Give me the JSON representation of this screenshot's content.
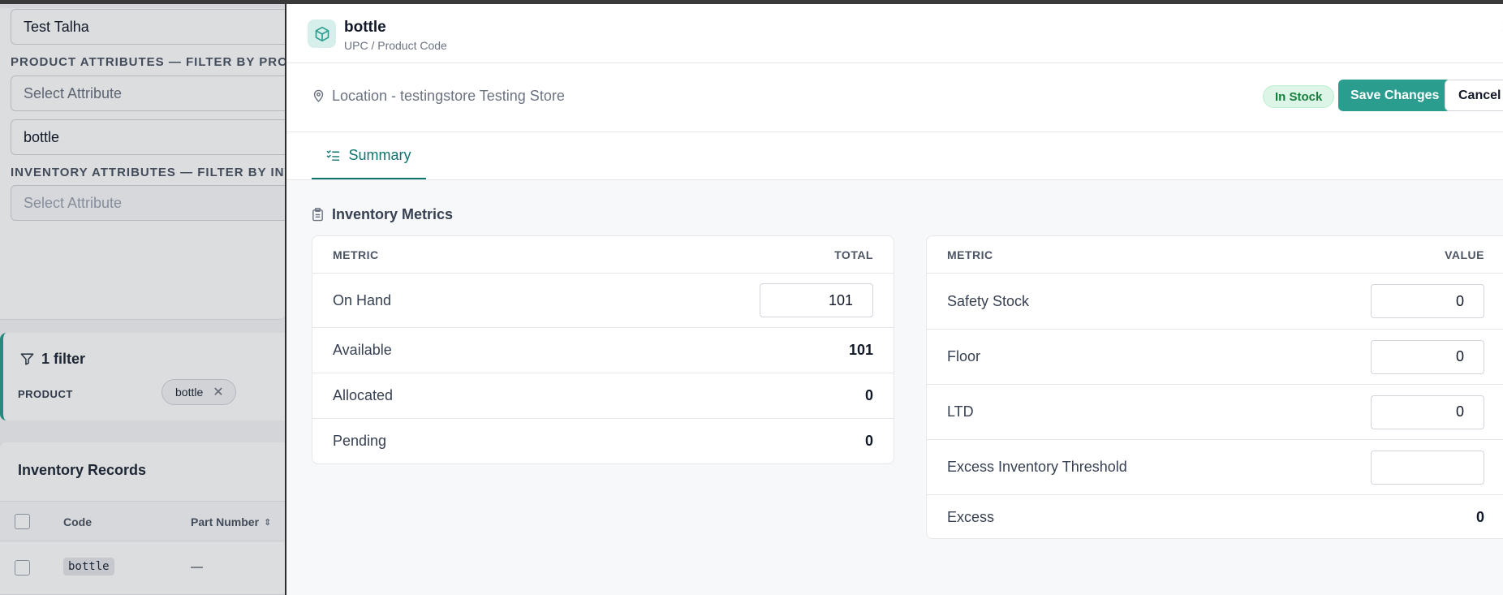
{
  "background": {
    "user_value": "Test Talha",
    "product_attributes_label": "PRODUCT ATTRIBUTES — FILTER BY PRODUCT",
    "product_attribute_placeholder": "Select Attribute",
    "product_value": "bottle",
    "inventory_attributes_label": "INVENTORY ATTRIBUTES — FILTER BY INVENTORY",
    "inventory_attribute_placeholder": "Select Attribute",
    "filter_count_label": "1 filter",
    "filter_product_label": "PRODUCT",
    "filter_chip_value": "bottle",
    "records_title": "Inventory Records",
    "columns": [
      "Code",
      "Part Number"
    ],
    "row_code": "bottle",
    "row_part_number": "—"
  },
  "drawer": {
    "product_name": "bottle",
    "product_subtitle": "UPC / Product Code",
    "location": "Location - testingstore Testing Store",
    "status_badge": "In Stock",
    "save_label": "Save Changes",
    "cancel_label": "Cancel",
    "tabs": [
      {
        "label": "Summary"
      }
    ],
    "section_title": "Inventory Metrics",
    "left_table": {
      "headers": [
        "METRIC",
        "TOTAL"
      ],
      "rows": [
        {
          "label": "On Hand",
          "value": "101"
        },
        {
          "label": "Available",
          "value": "101"
        },
        {
          "label": "Allocated",
          "value": "0"
        },
        {
          "label": "Pending",
          "value": "0"
        }
      ]
    },
    "right_table": {
      "headers": [
        "METRIC",
        "VALUE"
      ],
      "rows": [
        {
          "label": "Safety Stock",
          "value": "0"
        },
        {
          "label": "Floor",
          "value": "0"
        },
        {
          "label": "LTD",
          "value": "0"
        },
        {
          "label": "Excess Inventory Threshold",
          "value": ""
        },
        {
          "label": "Excess",
          "value": "0"
        }
      ]
    }
  },
  "colors": {
    "accent": "#2a9d8f",
    "tab_active": "#0f766e",
    "badge_bg": "#dcf5e7",
    "badge_text": "#15803d"
  }
}
